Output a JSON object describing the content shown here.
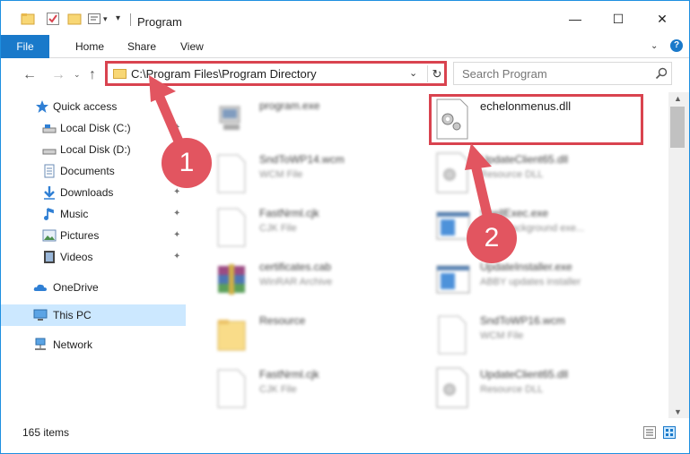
{
  "window": {
    "title": "Program",
    "minimize_glyph": "—",
    "maximize_glyph": "☐",
    "close_glyph": "✕"
  },
  "ribbon": {
    "tabs": [
      "File",
      "Home",
      "Share",
      "View"
    ],
    "expand_glyph": "⌄",
    "help_glyph": "?"
  },
  "navigation": {
    "back_glyph": "←",
    "forward_glyph": "→",
    "recent_glyph": "⌄",
    "up_glyph": "↑",
    "address": "C:\\Program Files\\Program Directory",
    "address_dropdown_glyph": "⌄",
    "refresh_glyph": "↻",
    "search_placeholder": "Search Program"
  },
  "sidebar": {
    "items": [
      {
        "label": "Quick access",
        "icon": "star-icon",
        "pinned": false
      },
      {
        "label": "Local Disk (C:)",
        "icon": "drive-icon",
        "pinned": true
      },
      {
        "label": "Local Disk (D:)",
        "icon": "drive-icon",
        "pinned": false
      },
      {
        "label": "Documents",
        "icon": "documents-icon",
        "pinned": true
      },
      {
        "label": "Downloads",
        "icon": "downloads-icon",
        "pinned": true
      },
      {
        "label": "Music",
        "icon": "music-icon",
        "pinned": true
      },
      {
        "label": "Pictures",
        "icon": "pictures-icon",
        "pinned": true
      },
      {
        "label": "Videos",
        "icon": "videos-icon",
        "pinned": true
      },
      {
        "label": "OneDrive",
        "icon": "cloud-icon",
        "pinned": false
      },
      {
        "label": "This PC",
        "icon": "computer-icon",
        "pinned": false,
        "selected": true
      },
      {
        "label": "Network",
        "icon": "network-icon",
        "pinned": false
      }
    ],
    "pin_glyph": "📌"
  },
  "files": [
    {
      "name": "program.exe",
      "desc": "",
      "icon": "exe-icon"
    },
    {
      "name": "echelonmenus.dll",
      "desc": "",
      "icon": "dll-icon"
    },
    {
      "name": "SndToWP14.wcm",
      "desc": "WCM File",
      "icon": "blank-file-icon"
    },
    {
      "name": "UpdateClient65.dll",
      "desc": "Resource DLL",
      "icon": "dll-icon"
    },
    {
      "name": "FastNrml.cjk",
      "desc": "CJK File",
      "icon": "blank-file-icon"
    },
    {
      "name": "ShellExec.exe",
      "desc": "GRM background exe...",
      "icon": "app-window-icon"
    },
    {
      "name": "certificates.cab",
      "desc": "WinRAR Archive",
      "icon": "archive-icon"
    },
    {
      "name": "UpdateInstaller.exe",
      "desc": "ABBY updates installer",
      "icon": "app-window-icon"
    },
    {
      "name": "Resource",
      "desc": "",
      "icon": "folder-icon"
    },
    {
      "name": "SndToWP16.wcm",
      "desc": "WCM File",
      "icon": "blank-file-icon"
    },
    {
      "name": "FastNrml.cjk",
      "desc": "CJK File",
      "icon": "blank-file-icon"
    },
    {
      "name": "UpdateClient65.dll",
      "desc": "Resource DLL",
      "icon": "dll-icon"
    }
  ],
  "status": {
    "item_count": "165 items"
  },
  "annotations": {
    "step1": "1",
    "step2": "2",
    "color": "#d9434f"
  },
  "colors": {
    "accent": "#1979ca",
    "selected": "#cce8ff",
    "callout": "#e25560"
  }
}
